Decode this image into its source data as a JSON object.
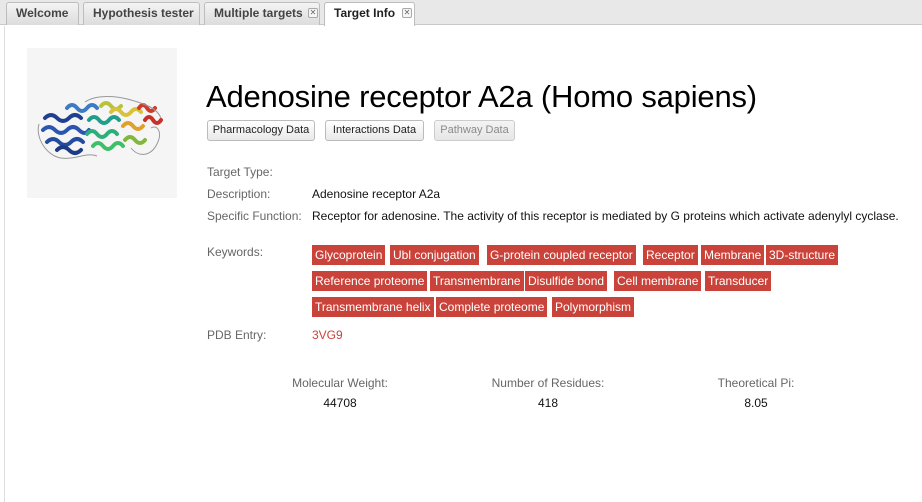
{
  "tabs": [
    {
      "label": "Welcome",
      "closable": false,
      "active": false
    },
    {
      "label": "Hypothesis tester",
      "closable": false,
      "active": false
    },
    {
      "label": "Multiple targets",
      "closable": true,
      "active": false
    },
    {
      "label": "Target Info",
      "closable": true,
      "active": true
    }
  ],
  "close_glyph": "✕",
  "target": {
    "title": "Adenosine receptor A2a (Homo sapiens)",
    "image_icon": "protein-structure-icon"
  },
  "buttons": {
    "pharmacology": "Pharmacology Data",
    "interactions": "Interactions Data",
    "pathway": "Pathway Data"
  },
  "fields": {
    "target_type_label": "Target Type:",
    "target_type_value": "",
    "description_label": "Description:",
    "description_value": "Adenosine receptor A2a",
    "specific_function_label": "Specific Function:",
    "specific_function_value": "Receptor for adenosine. The activity of this receptor is mediated by G proteins which activate adenylyl cyclase.",
    "keywords_label": "Keywords:",
    "pdb_label": "PDB Entry:",
    "pdb_value": "3VG9"
  },
  "keywords": [
    "Glycoprotein",
    "Ubl conjugation",
    "G-protein coupled receptor",
    "Receptor",
    "Membrane",
    "3D-structure",
    "Reference proteome",
    "Transmembrane",
    "Disulfide bond",
    "Cell membrane",
    "Transducer",
    "Transmembrane helix",
    "Complete proteome",
    "Polymorphism"
  ],
  "stats": {
    "mw_label": "Molecular Weight:",
    "mw_value": "44708",
    "residues_label": "Number of Residues:",
    "residues_value": "418",
    "pi_label": "Theoretical Pi:",
    "pi_value": "8.05"
  },
  "colors": {
    "keyword_bg": "#c9433a",
    "pdb_link": "#c9433a"
  }
}
